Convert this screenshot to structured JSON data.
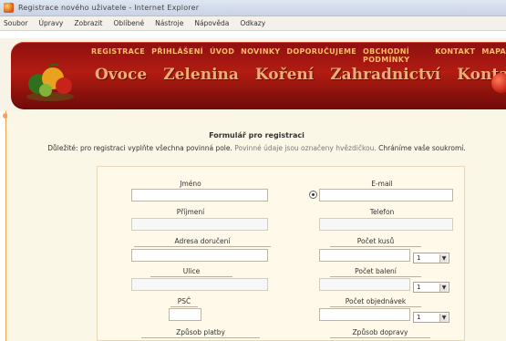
{
  "window": {
    "title": "Registrace nového uživatele - Internet Explorer"
  },
  "menubar": {
    "items": [
      "Soubor",
      "Úpravy",
      "Zobrazit",
      "Oblíbené",
      "Nástroje",
      "Nápověda",
      "Odkazy"
    ]
  },
  "header": {
    "topnav": [
      "REGISTRACE",
      "PŘIHLÁŠENÍ",
      "ÚVOD",
      "NOVINKY",
      "DOPORUČUJEME",
      "OBCHODNÍ PODMÍNKY",
      "KONTAKT",
      "MAPA"
    ],
    "mainnav": [
      "Ovoce",
      "Zelenina",
      "Koření",
      "Zahradnictví",
      "Kontakt"
    ]
  },
  "form": {
    "title": "Formulář pro registraci",
    "note": "Důležité: pro registraci vyplňte všechna povinná pole.",
    "note_faded": "Povinné údaje jsou označeny hvězdičkou.",
    "note_end": "Chráníme vaše soukromí.",
    "labels": {
      "first_name": "Jméno",
      "email": "E-mail",
      "last_name": "Příjmení",
      "phone": "Telefon",
      "address": "Adresa doručení",
      "num1": "Počet kusů",
      "street": "Ulice",
      "num2": "Počet balení",
      "zip": "PSČ",
      "num3": "Počet objednávek",
      "city_select": "Způsob platby",
      "delivery": "Způsob dopravy"
    },
    "selects": {
      "qty1": "1",
      "qty2": "1",
      "qty3": "1"
    }
  }
}
